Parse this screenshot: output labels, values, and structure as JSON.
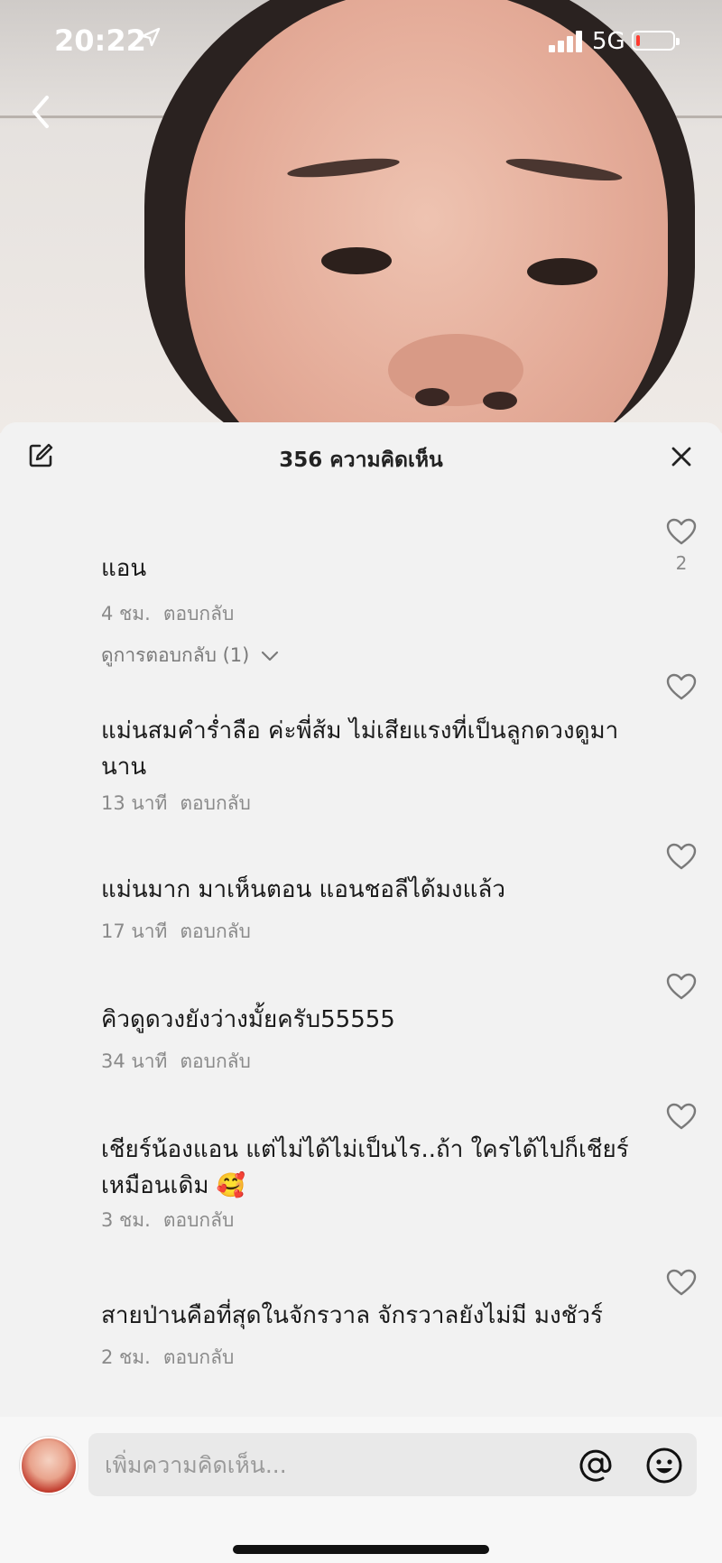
{
  "status_bar": {
    "time": "20:22",
    "network": "5G",
    "battery_level": 0.1
  },
  "header": {
    "comment_count_title": "356 ความคิดเห็น"
  },
  "comments": [
    {
      "text": "แอน",
      "time": "4 ชม.",
      "reply": "ตอบกลับ",
      "likes": "2",
      "view_replies": "ดูการตอบกลับ (1)"
    },
    {
      "text": "แม่นสมคำร่ำลือ ค่ะพี่ส้ม ไม่เสียแรงที่เป็นลูกดวงดูมานาน",
      "time": "13 นาที",
      "reply": "ตอบกลับ"
    },
    {
      "text": "แม่นมาก มาเห็นตอน แอนชอลีได้มงแล้ว",
      "time": "17 นาที",
      "reply": "ตอบกลับ"
    },
    {
      "text": "คิวดูดวงยังว่างมั้ยครับ55555",
      "time": "34 นาที",
      "reply": "ตอบกลับ"
    },
    {
      "text": "เชียร์น้องแอน แต่ไม่ได้ไม่เป็นไร..ถ้า ใครได้ไปก็เชียร์เหมือนเดิม 🥰",
      "time": "3 ชม.",
      "reply": "ตอบกลับ"
    },
    {
      "text": "สายป่านคือที่สุดในจักรวาล จักรวาลยังไม่มี มงชัวร์",
      "time": "2 ชม.",
      "reply": "ตอบกลับ"
    }
  ],
  "input": {
    "placeholder": "เพิ่มความคิดเห็น..."
  },
  "colors": {
    "sheet_bg": "#f2f2f2",
    "text": "#1a1a1a",
    "meta": "#8a8a8a",
    "battery_low": "#ff3b30"
  }
}
